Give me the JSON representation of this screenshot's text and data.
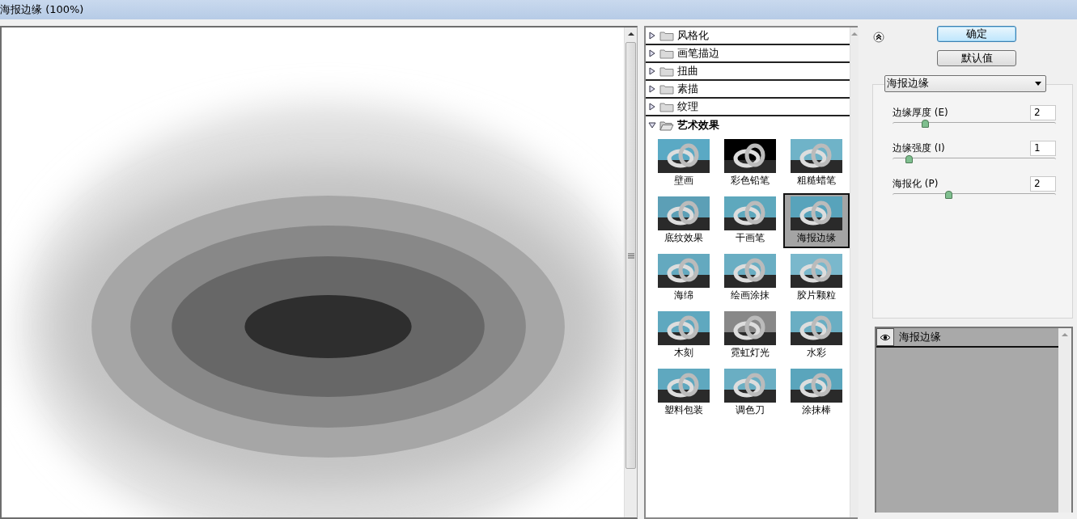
{
  "window": {
    "title": "海报边缘 (100%)"
  },
  "categories": [
    {
      "label": "风格化",
      "expanded": false
    },
    {
      "label": "画笔描边",
      "expanded": false
    },
    {
      "label": "扭曲",
      "expanded": false
    },
    {
      "label": "素描",
      "expanded": false
    },
    {
      "label": "纹理",
      "expanded": false
    },
    {
      "label": "艺术效果",
      "expanded": true,
      "filters": [
        {
          "label": "壁画",
          "selected": false
        },
        {
          "label": "彩色铅笔",
          "selected": false
        },
        {
          "label": "粗糙蜡笔",
          "selected": false
        },
        {
          "label": "底纹效果",
          "selected": false
        },
        {
          "label": "干画笔",
          "selected": false
        },
        {
          "label": "海报边缘",
          "selected": true
        },
        {
          "label": "海绵",
          "selected": false
        },
        {
          "label": "绘画涂抹",
          "selected": false
        },
        {
          "label": "胶片颗粒",
          "selected": false
        },
        {
          "label": "木刻",
          "selected": false
        },
        {
          "label": "霓虹灯光",
          "selected": false
        },
        {
          "label": "水彩",
          "selected": false
        },
        {
          "label": "塑料包装",
          "selected": false
        },
        {
          "label": "调色刀",
          "selected": false
        },
        {
          "label": "涂抹棒",
          "selected": false
        }
      ]
    }
  ],
  "buttons": [
    {
      "label": "确定",
      "default": true
    },
    {
      "label": "默认值",
      "default": false
    }
  ],
  "filter_select": {
    "value": "海报边缘"
  },
  "params": [
    {
      "label": "边缘厚度 (E)",
      "value": "2",
      "level": 0.2
    },
    {
      "label": "边缘强度 (I)",
      "value": "1",
      "level": 0.1
    },
    {
      "label": "海报化 (P)",
      "value": "2",
      "level": 0.34
    }
  ],
  "layers": [
    {
      "label": "海报边缘",
      "visible": true
    }
  ]
}
